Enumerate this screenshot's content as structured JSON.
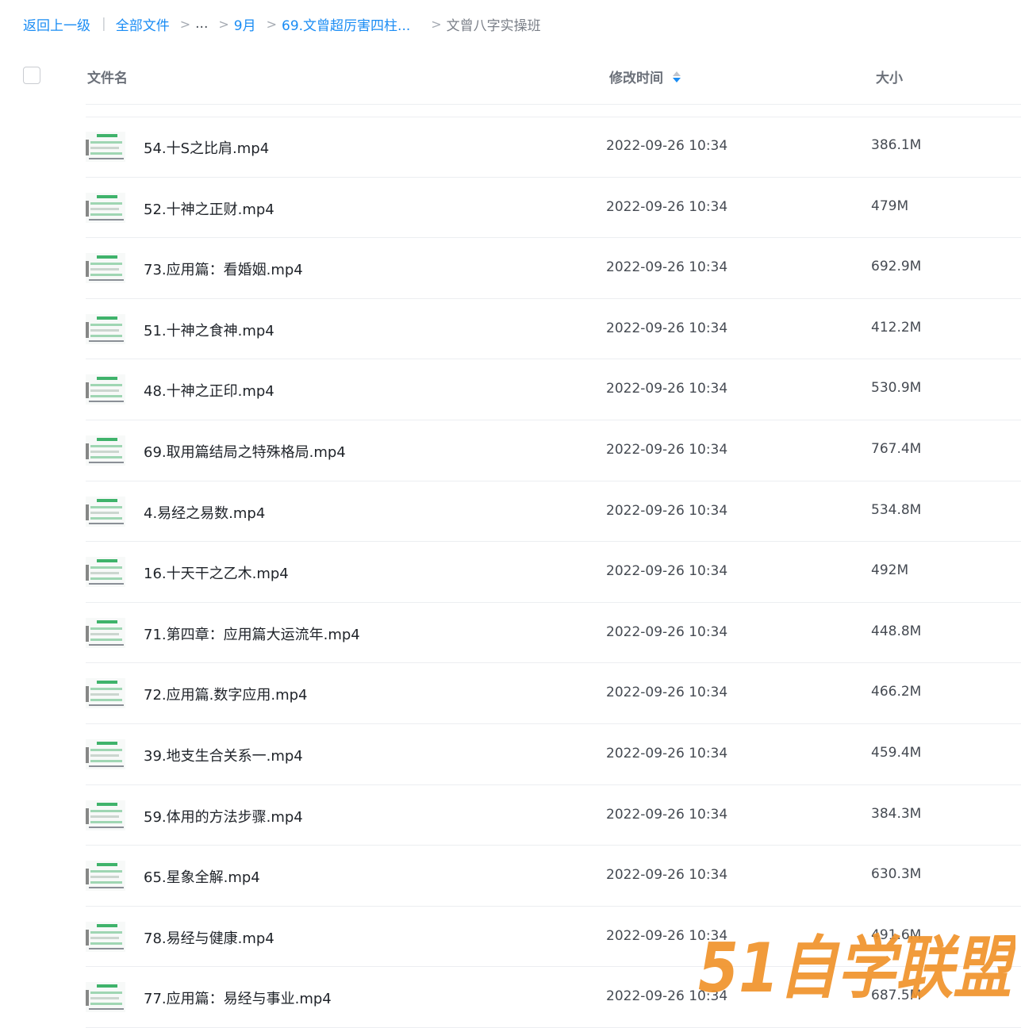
{
  "breadcrumb": {
    "back": "返回上一级",
    "all_files": "全部文件",
    "ellipsis": "...",
    "month": "9月",
    "course": "69.文曾超厉害四柱...",
    "current": "文曾八字实操班"
  },
  "table": {
    "col_name": "文件名",
    "col_time": "修改时间",
    "col_size": "大小"
  },
  "files": [
    {
      "name": "54.十S之比肩.mp4",
      "time": "2022-09-26 10:34",
      "size": "386.1M"
    },
    {
      "name": "52.十神之正财.mp4",
      "time": "2022-09-26 10:34",
      "size": "479M"
    },
    {
      "name": "73.应用篇：看婚姻.mp4",
      "time": "2022-09-26 10:34",
      "size": "692.9M"
    },
    {
      "name": "51.十神之食神.mp4",
      "time": "2022-09-26 10:34",
      "size": "412.2M"
    },
    {
      "name": "48.十神之正印.mp4",
      "time": "2022-09-26 10:34",
      "size": "530.9M"
    },
    {
      "name": "69.取用篇结局之特殊格局.mp4",
      "time": "2022-09-26 10:34",
      "size": "767.4M"
    },
    {
      "name": "4.易经之易数.mp4",
      "time": "2022-09-26 10:34",
      "size": "534.8M"
    },
    {
      "name": "16.十天干之乙木.mp4",
      "time": "2022-09-26 10:34",
      "size": "492M"
    },
    {
      "name": "71.第四章：应用篇大运流年.mp4",
      "time": "2022-09-26 10:34",
      "size": "448.8M"
    },
    {
      "name": "72.应用篇.数字应用.mp4",
      "time": "2022-09-26 10:34",
      "size": "466.2M"
    },
    {
      "name": "39.地支生合关系一.mp4",
      "time": "2022-09-26 10:34",
      "size": "459.4M"
    },
    {
      "name": "59.体用的方法步骤.mp4",
      "time": "2022-09-26 10:34",
      "size": "384.3M"
    },
    {
      "name": "65.星象全解.mp4",
      "time": "2022-09-26 10:34",
      "size": "630.3M"
    },
    {
      "name": "78.易经与健康.mp4",
      "time": "2022-09-26 10:34",
      "size": "491.6M"
    },
    {
      "name": "77.应用篇：易经与事业.mp4",
      "time": "2022-09-26 10:34",
      "size": "687.5M"
    }
  ],
  "watermark": "51自学联盟",
  "colors": {
    "accent": "#1a8cf4",
    "watermark": "#f0932b"
  }
}
